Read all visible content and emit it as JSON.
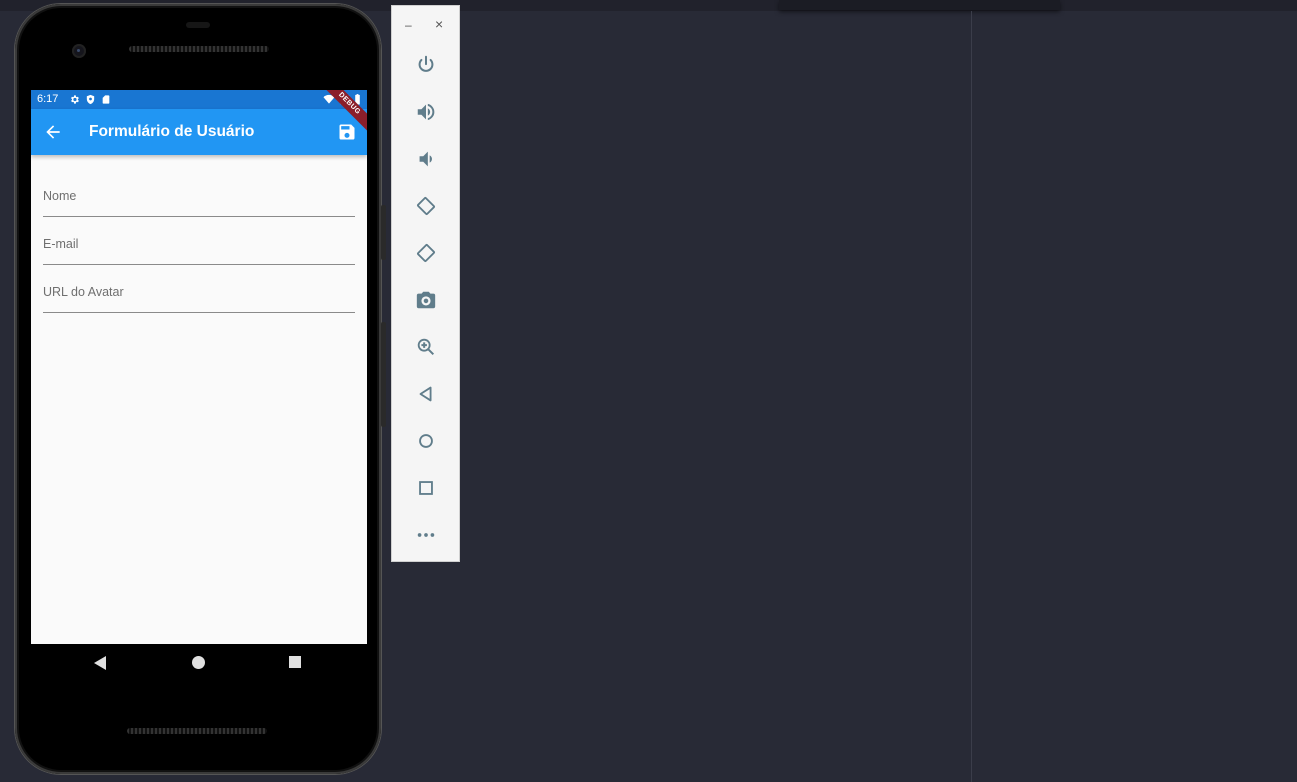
{
  "statusbar": {
    "time": "6:17"
  },
  "appbar": {
    "title": "Formulário de Usuário",
    "debug_banner": "DEBUG"
  },
  "form": {
    "fields": [
      {
        "label": "Nome",
        "value": ""
      },
      {
        "label": "E-mail",
        "value": ""
      },
      {
        "label": "URL do Avatar",
        "value": ""
      }
    ]
  },
  "emulator_toolbar": {
    "minimize_symbol": "–",
    "close_symbol": "×",
    "buttons": [
      {
        "icon": "power-icon"
      },
      {
        "icon": "volume-up-icon"
      },
      {
        "icon": "volume-down-icon"
      },
      {
        "icon": "rotate-left-icon"
      },
      {
        "icon": "rotate-right-icon"
      },
      {
        "icon": "camera-icon"
      },
      {
        "icon": "zoom-in-icon"
      },
      {
        "icon": "back-icon"
      },
      {
        "icon": "home-icon"
      },
      {
        "icon": "overview-icon"
      },
      {
        "icon": "more-icon"
      }
    ]
  },
  "colors": {
    "appbar": "#2196f3",
    "statusbar": "#1976d2",
    "ide_background": "#282a36",
    "toolbar_icon": "#607d8b"
  }
}
